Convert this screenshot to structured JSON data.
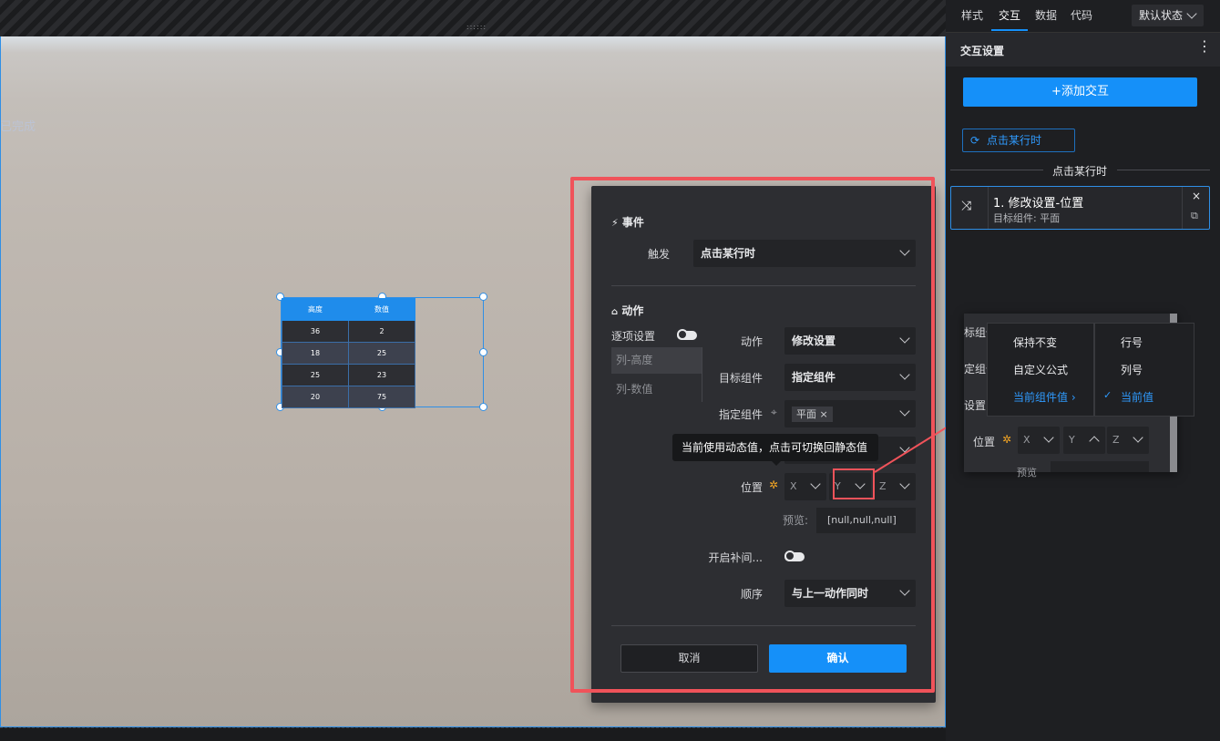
{
  "canvas": {
    "grip": "::::::",
    "done_text": "已完成"
  },
  "table_widget": {
    "headers": [
      "高度",
      "数值"
    ],
    "rows": [
      [
        "36",
        "2"
      ],
      [
        "18",
        "25"
      ],
      [
        "25",
        "23"
      ],
      [
        "20",
        "75"
      ]
    ]
  },
  "dialog": {
    "event_title": "事件",
    "trigger_label": "触发",
    "trigger_value": "点击某行时",
    "action_title": "动作",
    "item_settings_label": "逐项设置",
    "item_list": [
      "列-高度",
      "列-数值"
    ],
    "action_label": "动作",
    "action_value": "修改设置",
    "target_label": "目标组件",
    "target_value": "指定组件",
    "specified_label": "指定组件",
    "specified_tag": "平面",
    "position_label": "位置",
    "x_label": "X",
    "y_label": "Y",
    "z_label": "Z",
    "preview_label": "预览:",
    "preview_value": "[null,null,null]",
    "tween_label": "开启补间...",
    "order_label": "顺序",
    "order_value": "与上一动作同时",
    "cancel_label": "取消",
    "confirm_label": "确认",
    "tooltip": "当前使用动态值，点击可切换回静态值"
  },
  "panel": {
    "tabs": [
      "样式",
      "交互",
      "数据",
      "代码"
    ],
    "active_tab": "交互",
    "state_select": "默认状态",
    "header_title": "交互设置",
    "add_button": "+添加交互",
    "event_chip": "点击某行时",
    "event_divider_label": "点击某行时",
    "action_card_title": "1. 修改设置-位置",
    "action_card_sub": "目标组件: 平面"
  },
  "popup_preview": {
    "partial_labels": [
      "标组件",
      "定组件",
      "设置"
    ],
    "position_label": "位置",
    "x_label": "X",
    "y_label": "Y",
    "z_label": "Z",
    "preview_partial": "预览",
    "menu1": [
      "保持不变",
      "自定义公式",
      "当前组件值"
    ],
    "menu1_active": "当前组件值",
    "menu2": [
      "行号",
      "列号",
      "当前值"
    ],
    "menu2_checked": "当前值"
  },
  "colors": {
    "accent": "#1590f9",
    "highlight": "#f0535a",
    "selection": "#2f8fe6"
  }
}
